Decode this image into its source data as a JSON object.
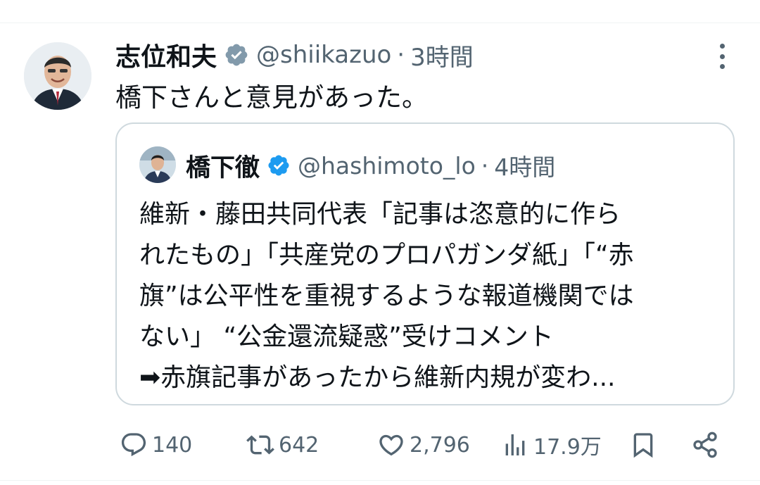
{
  "author": {
    "name": "志位和夫",
    "handle": "@shiikazuo",
    "separator": "·",
    "time": "3時間",
    "verified_color": "#829aab"
  },
  "tweet": {
    "text": "橋下さんと意見があった。"
  },
  "quote": {
    "name": "橋下徹",
    "handle": "@hashimoto_lo",
    "separator": "·",
    "time": "4時間",
    "verified_color": "#1d9bf0",
    "lines": [
      "維新・藤田共同代表「記事は恣意的に作ら",
      "れたもの」「共産党のプロパガンダ紙」「“赤",
      "旗”は公平性を重視するような報道機関では",
      "ない」 “公金還流疑惑”受けコメント",
      "➡赤旗記事があったから維新内規が変わ..."
    ]
  },
  "actions": {
    "replies": "140",
    "reposts": "642",
    "likes": "2,796",
    "views": "17.9万"
  },
  "icons": {
    "reply": "reply-icon",
    "repost": "repost-icon",
    "like": "like-icon",
    "views": "views-icon",
    "bookmark": "bookmark-icon",
    "share": "share-icon",
    "more": "more-icon",
    "verified": "verified-badge-icon"
  }
}
